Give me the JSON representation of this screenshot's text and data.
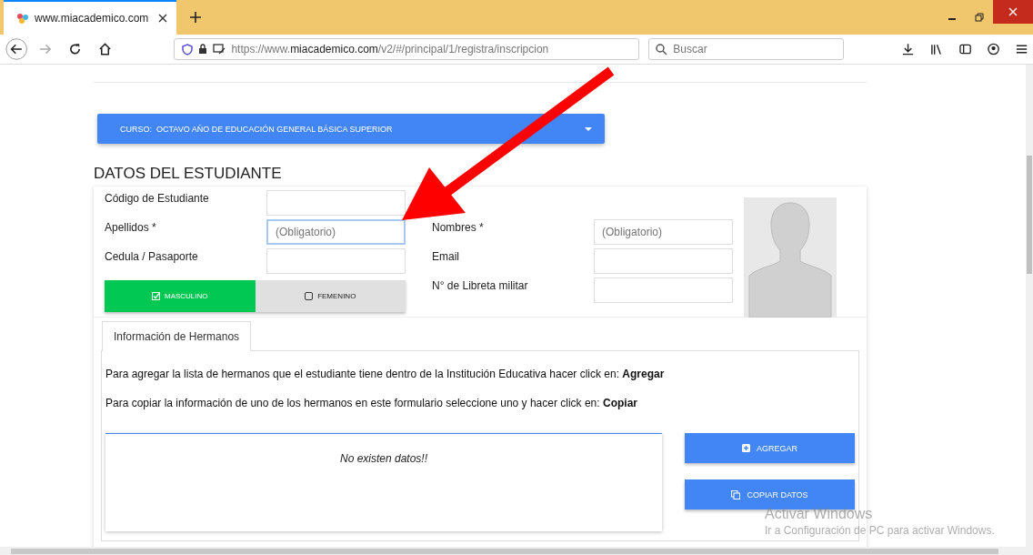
{
  "browser": {
    "tab": {
      "title": "www.miacademico.com",
      "selected": true
    },
    "url": {
      "prefix": "https://www.",
      "domain": "miacademico.com",
      "path": "/v2/#/principal/1/registra/inscripcion"
    },
    "search": {
      "placeholder": "Buscar"
    }
  },
  "course": {
    "label": "CURSO:",
    "value": "OCTAVO AÑO DE EDUCACIÓN GENERAL BÁSICA SUPERIOR"
  },
  "heading": "DATOS DEL ESTUDIANTE",
  "left_fields": [
    {
      "label": "Código de Estudiante",
      "focused": false
    },
    {
      "label": "Apellidos *",
      "placeholder": "(Obligatorio)",
      "focused": true
    },
    {
      "label": "Cedula / Pasaporte",
      "focused": false
    }
  ],
  "gender": [
    {
      "label": "MASCULINO",
      "selected": true
    },
    {
      "label": "FEMENINO",
      "selected": false
    }
  ],
  "right_fields": [
    {
      "label": "Nombres *",
      "placeholder": "(Obligatorio)",
      "focused": false
    },
    {
      "label": "Email",
      "focused": false
    },
    {
      "label": "N° de Libreta militar",
      "focused": false
    }
  ],
  "tabs": [
    {
      "label": "Información de Hermanos",
      "selected": true
    }
  ],
  "instructions": [
    "Para agregar la lista de hermanos que el estudiante tiene dentro de la Institución Educativa hacer click en: **Agregar**",
    "Para copiar la información de uno de los hermanos en este formulario seleccione uno y hacer click en: **Copiar**"
  ],
  "table": {
    "empty_message": "No existen datos!!"
  },
  "buttons": [
    {
      "kind": "add",
      "label": "AGREGAR"
    },
    {
      "kind": "copy",
      "label": "COPIAR DATOS"
    }
  ],
  "activation": {
    "title": "Activar Windows",
    "text": "Ir a Configuración de PC para activar Windows."
  }
}
